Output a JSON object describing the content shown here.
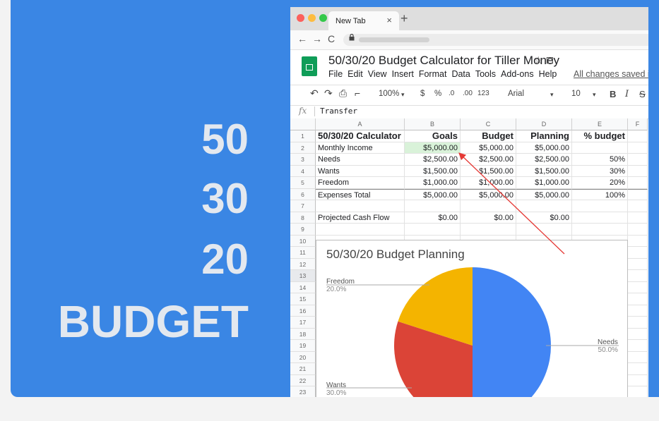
{
  "banner": {
    "lines": [
      "50",
      "30",
      "20",
      "BUDGET"
    ],
    "background": "#3a86e4",
    "text_color": "#e3e8ef"
  },
  "browser": {
    "tab_title": "New Tab",
    "tab_close": "×",
    "new_tab": "+",
    "nav": {
      "back": "←",
      "forward": "→",
      "reload": "C"
    },
    "lock_icon": "lock-icon"
  },
  "sheets": {
    "title": "50/30/20 Budget Calculator for Tiller Money",
    "title_icons": "☆ ⊡",
    "menu": [
      "File",
      "Edit",
      "View",
      "Insert",
      "Format",
      "Data",
      "Tools",
      "Add-ons",
      "Help"
    ],
    "saved_status": "All changes saved in D",
    "toolbar": {
      "undo": "↶",
      "redo": "↷",
      "print": "⎙",
      "paint": "⌐",
      "zoom": "100%",
      "zoom_caret": "▾",
      "currency": "$",
      "percent": "%",
      "dec_less": ".0",
      "dec_more": ".00",
      "format": "123",
      "font": "Arial",
      "font_caret": "▾",
      "font_size": "10",
      "size_caret": "▾",
      "bold": "B",
      "italic": "I",
      "strike": "S"
    },
    "formula_bar": {
      "label": "fx",
      "value": "Transfer"
    },
    "columns": [
      "A",
      "B",
      "C",
      "D",
      "E",
      "F"
    ],
    "rows": [
      [
        "50/30/20 Calculator",
        "Goals",
        "Budget",
        "Planning",
        "% budget"
      ],
      [
        "Monthly Income",
        "$5,000.00",
        "$5,000.00",
        "$5,000.00",
        ""
      ],
      [
        "Needs",
        "$2,500.00",
        "$2,500.00",
        "$2,500.00",
        "50%"
      ],
      [
        "Wants",
        "$1,500.00",
        "$1,500.00",
        "$1,500.00",
        "30%"
      ],
      [
        "Freedom",
        "$1,000.00",
        "$1,000.00",
        "$1,000.00",
        "20%"
      ],
      [
        "Expenses Total",
        "$5,000.00",
        "$5,000.00",
        "$5,000.00",
        "100%"
      ],
      [
        "",
        "",
        "",
        "",
        ""
      ],
      [
        "Projected Cash Flow",
        "$0.00",
        "$0.00",
        "$0.00",
        ""
      ]
    ],
    "row_numbers": [
      "1",
      "2",
      "3",
      "4",
      "5",
      "6",
      "7",
      "8",
      "9",
      "10",
      "11",
      "12",
      "13",
      "14",
      "15",
      "16",
      "17",
      "18",
      "19",
      "20",
      "21",
      "22",
      "23"
    ],
    "selected_row": "13",
    "highlight_color": "#d9f2d9"
  },
  "chart_data": {
    "type": "pie",
    "title": "50/30/20 Budget Planning",
    "slices": [
      {
        "name": "Needs",
        "value": 50.0,
        "label": "50.0%",
        "color": "#4285f4"
      },
      {
        "name": "Wants",
        "value": 30.0,
        "label": "30.0%",
        "color": "#db4437"
      },
      {
        "name": "Freedom",
        "value": 20.0,
        "label": "20.0%",
        "color": "#f4b400"
      }
    ]
  },
  "annotation_color": "#e53935"
}
